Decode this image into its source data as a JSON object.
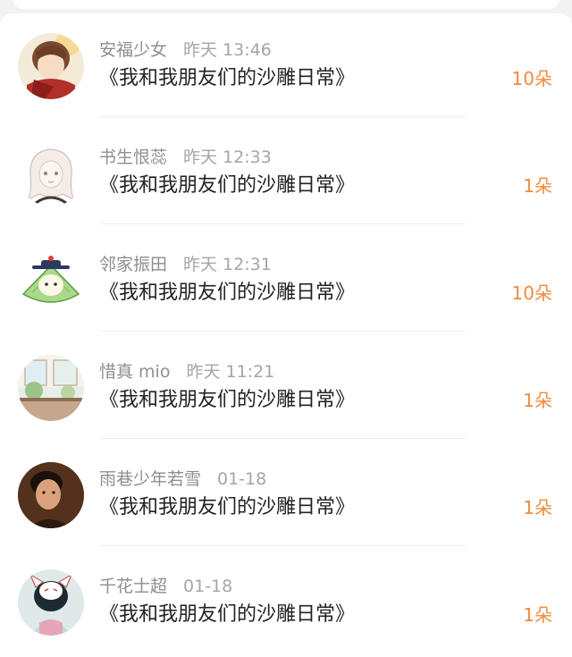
{
  "colors": {
    "background": "#f2f2f4",
    "card": "#ffffff",
    "name_text": "#8e8e93",
    "title_text": "#222222",
    "accent_orange": "#f08a3c"
  },
  "gift_list": [
    {
      "user": "安福少女",
      "time": "昨天 13:46",
      "title": "《我和我朋友们的沙雕日常》",
      "count": "10朵",
      "avatar_icon": "boy-with-red-scarf-avatar"
    },
    {
      "user": "书生恨蕊",
      "time": "昨天 12:33",
      "title": "《我和我朋友们的沙雕日常》",
      "count": "1朵",
      "avatar_icon": "anime-girl-sketch-avatar"
    },
    {
      "user": "邻家振田",
      "time": "昨天 12:31",
      "title": "《我和我朋友们的沙雕日常》",
      "count": "10朵",
      "avatar_icon": "cartoon-zongzi-official-avatar"
    },
    {
      "user": "惜真 mio",
      "time": "昨天 11:21",
      "title": "《我和我朋友们的沙雕日常》",
      "count": "1朵",
      "avatar_icon": "window-scenery-avatar"
    },
    {
      "user": "雨巷少年若雪",
      "time": "01-18",
      "title": "《我和我朋友们的沙雕日常》",
      "count": "1朵",
      "avatar_icon": "man-portrait-avatar"
    },
    {
      "user": "千花士超",
      "time": "01-18",
      "title": "《我和我朋友们的沙雕日常》",
      "count": "1朵",
      "avatar_icon": "fox-mask-girl-avatar"
    }
  ]
}
